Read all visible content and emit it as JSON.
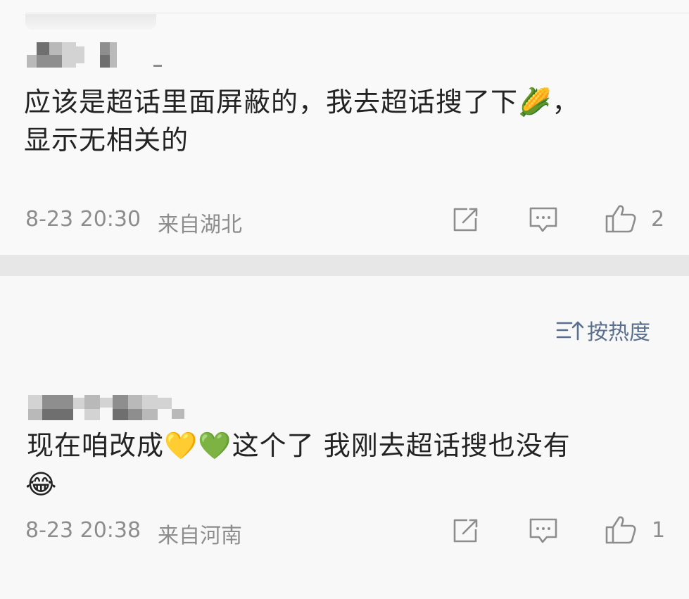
{
  "comments": [
    {
      "text_line1": "应该是超话里面屏蔽的，我去超话搜了下🌽，",
      "text_line2": "显示无相关的",
      "date": "8-23 20:30",
      "location": "来自湖北",
      "likes": "2"
    },
    {
      "text_line1": "现在咱改成💛💚这个了 我刚去超话搜也没有",
      "text_line2": "😂",
      "date": "8-23 20:38",
      "location": "来自河南",
      "likes": "1"
    }
  ],
  "sort": {
    "label": "按热度"
  },
  "icons": {
    "share": "share-icon",
    "comment": "comment-icon",
    "like": "thumbs-up-icon",
    "sort": "sort-icon"
  },
  "colors": {
    "meta": "#8d8d8d",
    "sort_link": "#5a6e8f",
    "divider": "#e7e7e7"
  }
}
